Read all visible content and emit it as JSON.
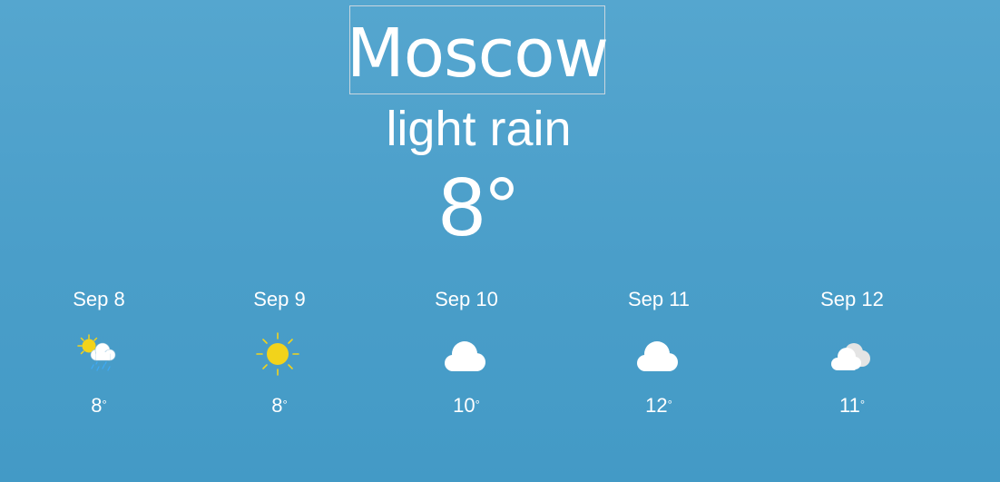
{
  "city": "Moscow",
  "current": {
    "condition": "light rain",
    "temperature": "8°"
  },
  "forecast": [
    {
      "date": "Sep 8",
      "icon": "sun-cloud-rain-icon",
      "temp": "8",
      "deg": "°"
    },
    {
      "date": "Sep 9",
      "icon": "sun-icon",
      "temp": "8",
      "deg": "°"
    },
    {
      "date": "Sep 10",
      "icon": "cloud-icon",
      "temp": "10",
      "deg": "°"
    },
    {
      "date": "Sep 11",
      "icon": "cloud-icon",
      "temp": "12",
      "deg": "°"
    },
    {
      "date": "Sep 12",
      "icon": "clouds-icon",
      "temp": "11",
      "deg": "°"
    }
  ],
  "colors": {
    "background": "#4a9ec9",
    "text": "#ffffff",
    "sun": "#f2d31b",
    "rain": "#3fa9f5",
    "cloud": "#ffffff"
  }
}
